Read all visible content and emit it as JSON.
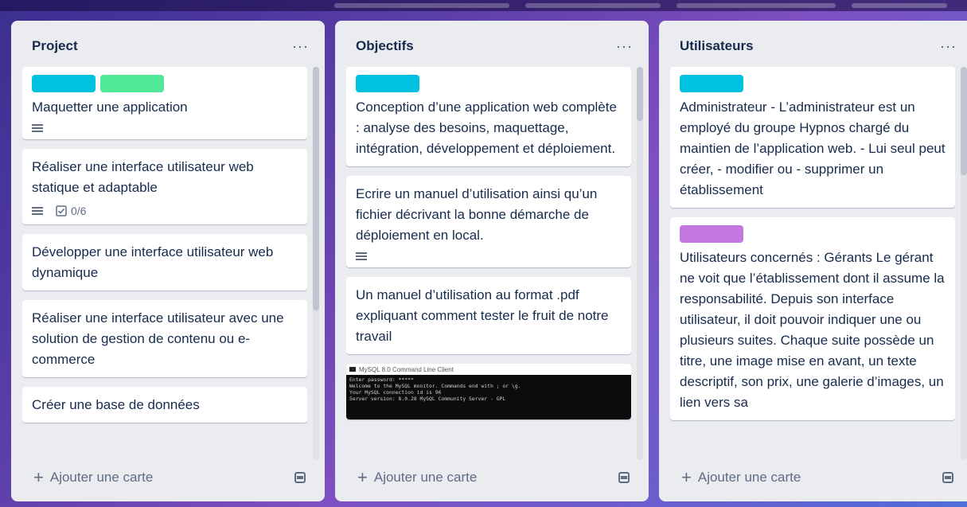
{
  "colors": {
    "label_cyan": "#00c2e0",
    "label_green": "#51e898",
    "label_purple": "#c377e0"
  },
  "lists": [
    {
      "title": "Project",
      "menu": "···",
      "add_card": "Ajouter une carte",
      "cards": [
        {
          "labels": [
            "label_cyan",
            "label_green"
          ],
          "title": "Maquetter une application",
          "badges": {
            "description": true
          }
        },
        {
          "labels": [],
          "title": "Réaliser une interface utilisateur web statique et adaptable",
          "badges": {
            "description": true,
            "checklist": "0/6"
          }
        },
        {
          "labels": [],
          "title": "Développer une interface utilisateur web dynamique"
        },
        {
          "labels": [],
          "title": "Réaliser une interface utilisateur avec une solution de gestion de contenu ou e-commerce"
        },
        {
          "labels": [],
          "title": "Créer une base de données"
        }
      ]
    },
    {
      "title": "Objectifs",
      "menu": "···",
      "add_card": "Ajouter une carte",
      "cards": [
        {
          "labels": [
            "label_cyan"
          ],
          "title": "Conception d’une application web complète : analyse des besoins, maquettage, intégration, développement et déploiement."
        },
        {
          "labels": [],
          "title": "Ecrire un manuel d’utilisation ainsi qu’un fichier décrivant la bonne démarche de déploiement en local.",
          "badges": {
            "description": true
          }
        },
        {
          "labels": [],
          "title": "Un manuel d’utilisation au format .pdf expliquant comment tester le fruit de notre travail"
        }
      ],
      "terminal": {
        "title": "MySQL 8.0 Command Line Client",
        "lines": [
          "Enter password: *****",
          "Welcome to the MySQL monitor.  Commands end with ; or \\g.",
          "Your MySQL connection id is 96",
          "Server version: 8.0.28 MySQL Community Server - GPL"
        ]
      }
    },
    {
      "title": "Utilisateurs",
      "menu": "···",
      "add_card": "Ajouter une carte",
      "cards": [
        {
          "labels": [
            "label_cyan"
          ],
          "title": "Administrateur - L’administrateur est un employé du groupe Hypnos chargé du maintien de l’application web. - Lui seul peut créer, - modifier ou - supprimer un établissement"
        },
        {
          "labels": [
            "label_purple"
          ],
          "title": "Utilisateurs concernés : Gérants Le gérant ne voit que l’établissement dont il assume la responsabilité. Depuis son interface utilisateur, il doit pouvoir indiquer une ou plusieurs suites. Chaque suite possède un titre, une image mise en avant, un texte descriptif, son prix, une galerie d’images, un lien vers sa"
        }
      ]
    }
  ]
}
